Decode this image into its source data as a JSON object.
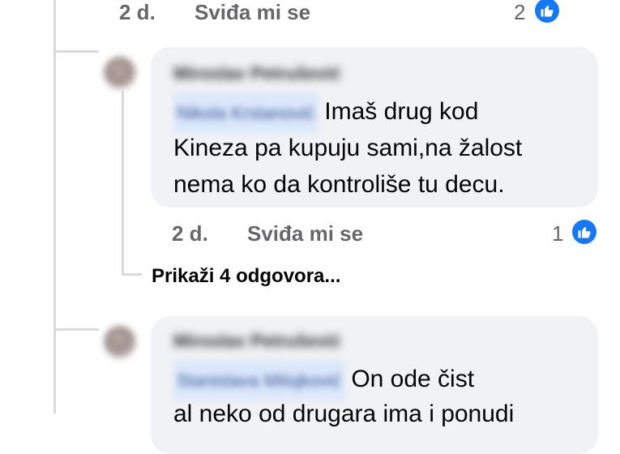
{
  "top_meta": {
    "time": "2 d.",
    "like_label": "Sviđa mi se",
    "reaction_count": "2"
  },
  "comments": [
    {
      "author": "Miroslav Petrušević",
      "mention": "Nikola Krstanović",
      "text_line1": "Imaš drug kod",
      "text_line2": "Kineza pa kupuju sami,na žalost",
      "text_line3": "nema ko da kontroliše tu decu.",
      "time": "2 d.",
      "like_label": "Sviđa mi se",
      "reaction_count": "1"
    },
    {
      "author": "Miroslav Petrušević",
      "mention": "Stanislava Milojković",
      "text_line1": "On ode čist",
      "text_line2": "al neko od drugara ima i ponudi"
    }
  ],
  "more_replies": "Prikaži 4 odgovora...",
  "colors": {
    "like_blue": "#1877f2",
    "bubble_bg": "#f0f2f5",
    "meta_gray": "#65676b"
  },
  "icons": {
    "like": "thumbs-up-icon"
  }
}
